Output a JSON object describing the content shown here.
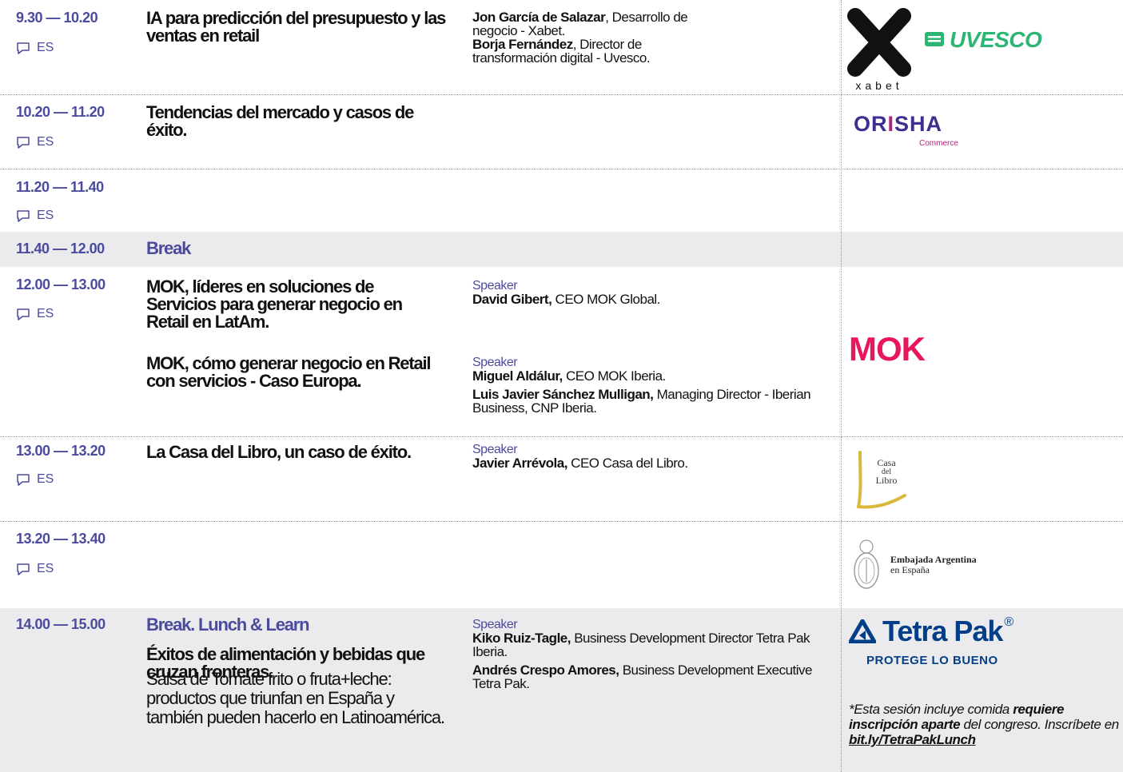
{
  "sessions": [
    {
      "time": "9.30 — 10.20",
      "lang": "ES",
      "title": "IA para predicción del presupuesto y las ventas en retail",
      "speakers": [
        {
          "name": "Jon García de Salazar",
          "role": ", Desarrollo de negocio - Xabet."
        },
        {
          "name": "Borja Fernández",
          "role": ", Director de transformación digital - Uvesco."
        }
      ]
    },
    {
      "time": "10.20 — 11.20",
      "lang": "ES",
      "title": "Tendencias del mercado y casos de éxito."
    },
    {
      "time": "11.20 — 11.40",
      "lang": "ES"
    },
    {
      "time": "11.40 — 12.00",
      "title": "Break"
    },
    {
      "time": "12.00 — 13.00",
      "lang": "ES",
      "title": "MOK, líderes en soluciones de Servicios para generar negocio en Retail en LatAm.",
      "speaker_label": "Speaker",
      "speakers": [
        {
          "name": "David Gibert,",
          "role": " CEO MOK Global."
        }
      ],
      "title2": "MOK, cómo generar negocio en Retail con servicios - Caso Europa.",
      "speaker_label2": "Speaker",
      "speakers2": [
        {
          "name": "Miguel Aldálur,",
          "role": " CEO MOK Iberia."
        },
        {
          "name": "Luis Javier Sánchez Mulligan,",
          "role": " Managing Director - Iberian Business, CNP Iberia."
        }
      ]
    },
    {
      "time": "13.00 — 13.20",
      "lang": "ES",
      "title": "La Casa del Libro, un caso de éxito.",
      "speaker_label": "Speaker",
      "speakers": [
        {
          "name": "Javier Arrévola,",
          "role": " CEO Casa del Libro."
        }
      ]
    },
    {
      "time": "13.20 — 13.40",
      "lang": "ES"
    },
    {
      "time": "14.00 — 15.00",
      "title": "Break. Lunch & Learn",
      "subtitle": "Éxitos de alimentación y bebidas que cruzan fronteras.",
      "description": "Salsa de Tomate frito o fruta+leche: productos que triunfan en España y también pueden hacerlo en Latinoamérica.",
      "speaker_label": "Speaker",
      "speakers": [
        {
          "name": "Kiko Ruiz-Tagle,",
          "role": " Business Development Director Tetra Pak Iberia."
        },
        {
          "name": "Andrés Crespo Amores,",
          "role": " Business Development Executive Tetra Pak."
        }
      ],
      "note": {
        "part1": "*Esta sesión incluye comida ",
        "bold": "requiere inscripción aparte",
        "part2": " del congreso. Inscríbete en ",
        "link": "bit.ly/TetraPakLunch"
      }
    }
  ],
  "logos": {
    "xabet": "xabet",
    "uvesco": "UVESCO",
    "orisha_left": "OR",
    "orisha_i": "I",
    "orisha_right": "SHA",
    "orisha_sub": "Commerce",
    "mok": "MOK",
    "casa_1": "Casa",
    "casa_2": "del",
    "casa_3": "Libro",
    "embajada_1": "Embajada Argentina",
    "embajada_2": "en España",
    "tetra": "Tetra Pak",
    "tetra_reg": "®",
    "tetra_tag": "PROTEGE LO BUENO"
  },
  "colors": {
    "time": "#4b4b9e",
    "shade": "#ebebee",
    "mok": "#e8175d",
    "orisha": "#3b2f8f",
    "uvesco": "#2bb673",
    "tetra": "#023f88",
    "casa": "#d9b83a"
  },
  "icons": {
    "lang": "speech-bubble-icon"
  }
}
